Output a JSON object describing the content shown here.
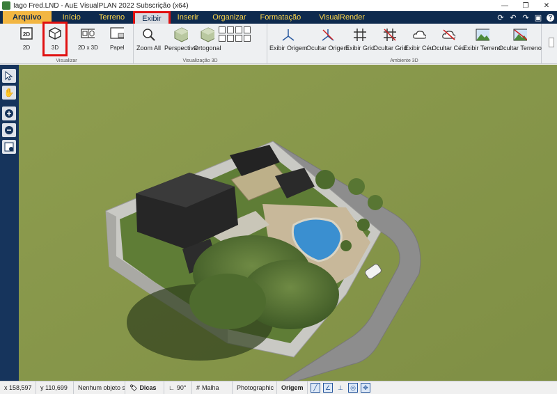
{
  "window": {
    "title": "Iago Fred.LND - AuE VisualPLAN 2022 Subscrição (x64)",
    "controls": {
      "minimize": "—",
      "maximize": "❐",
      "close": "✕"
    }
  },
  "menu": {
    "tabs": [
      {
        "label": "Arquivo"
      },
      {
        "label": "Início"
      },
      {
        "label": "Terreno"
      },
      {
        "label": "Exibir"
      },
      {
        "label": "Inserir"
      },
      {
        "label": "Organizar"
      },
      {
        "label": "Formatação"
      },
      {
        "label": "VisualRender"
      }
    ],
    "active_tab": "Exibir"
  },
  "ribbon": {
    "visualizar": {
      "label": "Visualizar",
      "buttons": [
        {
          "label": "2D",
          "icon": "2d-icon"
        },
        {
          "label": "3D",
          "icon": "cube-3d-icon"
        },
        {
          "label": "2D x 3D",
          "icon": "split-view-icon"
        },
        {
          "label": "Papel",
          "icon": "paper-icon"
        }
      ]
    },
    "visualizacao3d": {
      "label": "Visualização 3D",
      "buttons": [
        {
          "label": "Zoom All",
          "icon": "zoom-icon"
        },
        {
          "label": "Perspectiva",
          "icon": "perspective-cube-icon"
        },
        {
          "label": "Ortogonal",
          "icon": "orthogonal-cube-icon"
        }
      ]
    },
    "ambiente3d": {
      "label": "Ambiente 3D",
      "buttons": [
        {
          "label": "Exibir Origem",
          "icon": "axes-icon"
        },
        {
          "label": "Ocultar Origem",
          "icon": "axes-hide-icon"
        },
        {
          "label": "Exibir Grid",
          "icon": "grid-icon"
        },
        {
          "label": "Ocultar Grid",
          "icon": "grid-hide-icon"
        },
        {
          "label": "Exibir Céu",
          "icon": "cloud-icon"
        },
        {
          "label": "Ocultar Céu",
          "icon": "cloud-hide-icon"
        },
        {
          "label": "Exibir Terreno",
          "icon": "terrain-icon"
        },
        {
          "label": "Ocultar Terreno",
          "icon": "terrain-hide-icon"
        }
      ]
    }
  },
  "statusbar": {
    "x": "x 158,597",
    "y": "y 110,699",
    "selection": "Nenhum objeto sel",
    "tips": "Dicas",
    "angle": "90°",
    "mesh": "Malha",
    "render_mode": "Photographic",
    "origin": "Origem"
  },
  "colors": {
    "menubar": "#0e2a4e",
    "menu_text": "#ffd84a",
    "highlight": "#e01010",
    "grass": "#8a9a4c"
  }
}
